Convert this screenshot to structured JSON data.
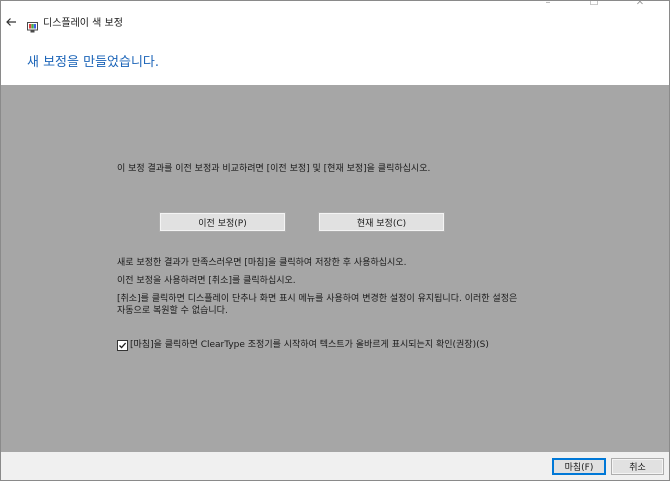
{
  "titlebar": {
    "title": "디스플레이 색 보정",
    "minimize_icon": "minimize-icon",
    "maximize_icon": "maximize-icon",
    "close_icon": "close-icon"
  },
  "header": {
    "title": "새 보정을 만들었습니다."
  },
  "content": {
    "compare_instruction": "이 보정 결과를 이전 보정과 비교하려면 [이전 보정] 및 [현재 보정]을 클릭하십시오.",
    "prev_button": "이전 보정(P)",
    "current_button": "현재 보정(C)",
    "para1": "새로 보정한 결과가 만족스러우면 [마침]을 클릭하여 저장한 후 사용하십시오.",
    "para2": "이전 보정을 사용하려면 [취소]를 클릭하십시오.",
    "para3_line1": "[취소]를 클릭하면 디스플레이 단추나 화면 표시 메뉴를 사용하여 변경한 설정이 유지됩니다. 이러한 설정은",
    "para3_line2": "자동으로 복원할 수 없습니다.",
    "cleartype_checkbox_label": "[마침]을 클릭하면 ClearType 조정기를 시작하여 텍스트가 올바르게 표시되는지 확인(권장)(S)",
    "cleartype_checked": true
  },
  "footer": {
    "finish_button": "마침(F)",
    "cancel_button": "취소"
  },
  "colors": {
    "header_title": "#1b64b8",
    "content_bg": "#a6a6a6",
    "default_button_border": "#0078d7"
  }
}
